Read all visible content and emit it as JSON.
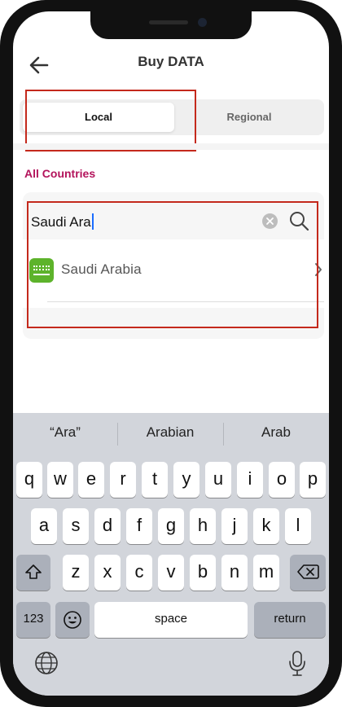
{
  "header": {
    "title": "Buy DATA"
  },
  "tabs": [
    {
      "label": "Local",
      "selected": true
    },
    {
      "label": "Regional",
      "selected": false
    }
  ],
  "section": {
    "title": "All Countries"
  },
  "search": {
    "value": "Saudi Ara"
  },
  "results": [
    {
      "label": "Saudi Arabia",
      "flag": "saudi-arabia-flag"
    }
  ],
  "keyboard": {
    "suggestions": [
      "“Ara”",
      "Arabian",
      "Arab"
    ],
    "row1": [
      "q",
      "w",
      "e",
      "r",
      "t",
      "y",
      "u",
      "i",
      "o",
      "p"
    ],
    "row2": [
      "a",
      "s",
      "d",
      "f",
      "g",
      "h",
      "j",
      "k",
      "l"
    ],
    "row3": [
      "z",
      "x",
      "c",
      "v",
      "b",
      "n",
      "m"
    ],
    "numbers_label": "123",
    "space_label": "space",
    "return_label": "return"
  },
  "colors": {
    "accent": "#b3135b",
    "highlight_box": "#c4291c",
    "flag_green": "#5db32b",
    "keyboard_bg": "#d2d5db"
  }
}
